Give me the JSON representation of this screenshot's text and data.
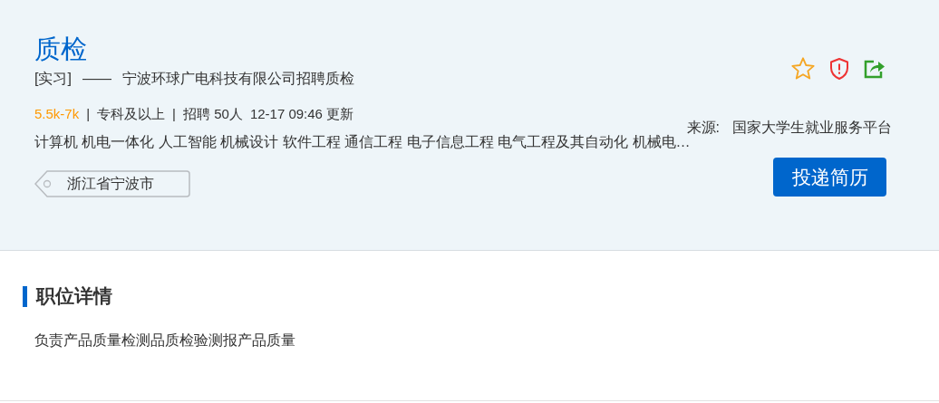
{
  "job": {
    "title": "质检",
    "type": "[实习]",
    "separator": "——",
    "company_line": "宁波环球广电科技有限公司招聘质检",
    "salary": "5.5k-7k",
    "divider": "|",
    "education": "专科及以上",
    "headcount": "招聘 50人",
    "updated": "12-17 09:46 更新",
    "majors": "计算机 机电一体化 人工智能 机械设计 软件工程 通信工程 电子信息工程 电气工程及其自动化 机械电…",
    "location": "浙江省宁波市",
    "source_label": "来源:",
    "source": "国家大学生就业服务平台",
    "apply_button": "投递简历",
    "favorited": false
  },
  "details": {
    "heading": "职位详情",
    "description": "负责产品质量检测品质检验测报产品质量"
  }
}
